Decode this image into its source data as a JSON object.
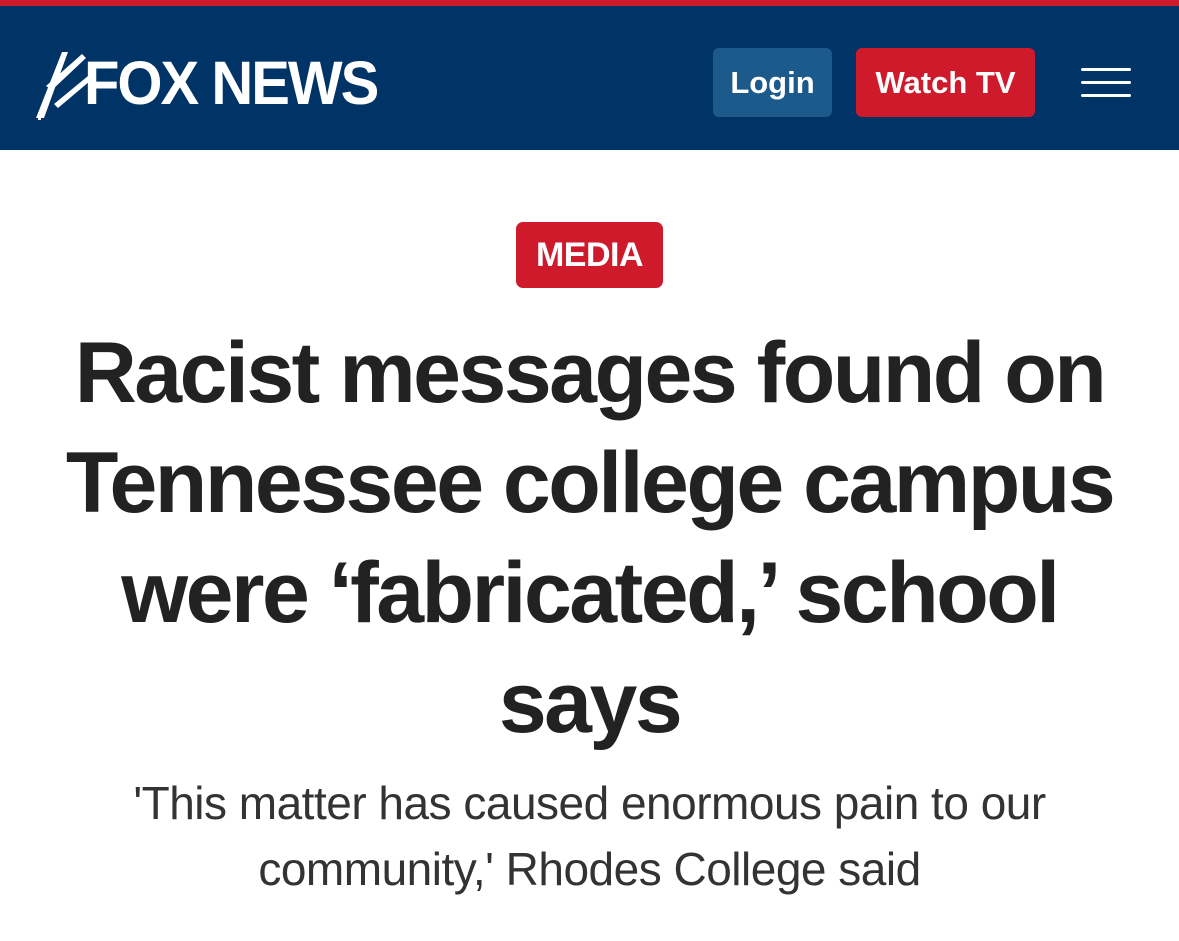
{
  "header": {
    "logo_text": "FOX NEWS",
    "login_label": "Login",
    "watch_label": "Watch TV",
    "menu_icon": "hamburger-menu-icon"
  },
  "article": {
    "category": "MEDIA",
    "headline": "Racist messages found on Tennessee college campus were ‘fabricated,’ school says",
    "subheadline": "'This matter has caused enormous pain to our community,' Rhodes College said"
  },
  "colors": {
    "brand_navy": "#003366",
    "accent_red": "#cf1a2b",
    "login_blue": "#1d5a8c",
    "headline_text": "#222222"
  }
}
